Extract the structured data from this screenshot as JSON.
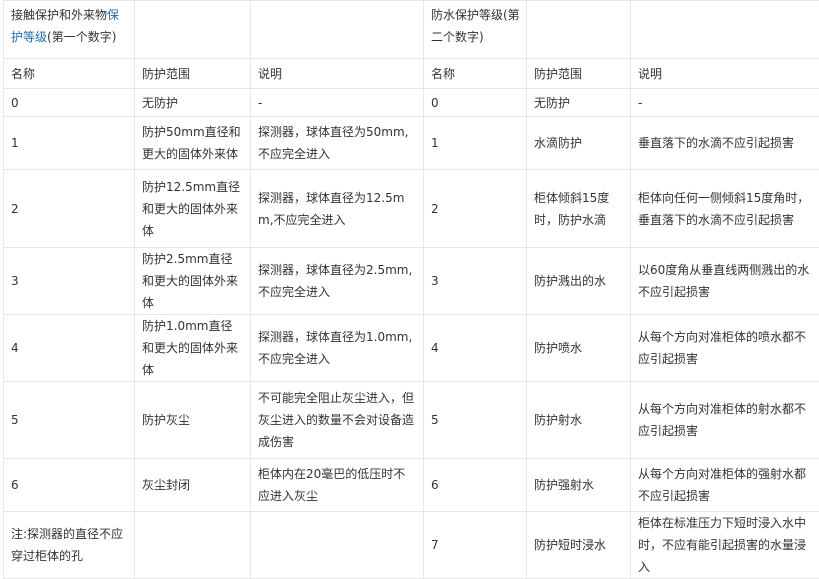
{
  "header": {
    "contact_title_prefix": "接触保护和外来物",
    "contact_title_link": "保护等级",
    "contact_title_suffix": "(第一个数字)",
    "water_title": "防水保护等级(第二个数字)"
  },
  "columns": {
    "name": "名称",
    "scope": "防护范围",
    "desc": "说明"
  },
  "rows": [
    {
      "c_name": "0",
      "c_scope": "无防护",
      "c_desc": "-",
      "w_name": "0",
      "w_scope": "无防护",
      "w_desc": "-"
    },
    {
      "c_name": "1",
      "c_scope": "防护50mm直径和更大的固体外来体",
      "c_desc": "探测器，球体直径为50mm,不应完全进入",
      "w_name": "1",
      "w_scope": "水滴防护",
      "w_desc": "垂直落下的水滴不应引起损害"
    },
    {
      "c_name": "2",
      "c_scope": "防护12.5mm直径和更大的固体外来体",
      "c_desc": "探测器，球体直径为12.5mm,不应完全进入",
      "w_name": "2",
      "w_scope": "柜体倾斜15度时，防护水滴",
      "w_desc": "柜体向任何一侧倾斜15度角时，垂直落下的水滴不应引起损害"
    },
    {
      "c_name": "3",
      "c_scope": "防护2.5mm直径和更大的固体外来体",
      "c_desc": "探测器，球体直径为2.5mm,不应完全进入",
      "w_name": "3",
      "w_scope": "防护溅出的水",
      "w_desc": "以60度角从垂直线两侧溅出的水不应引起损害"
    },
    {
      "c_name": "4",
      "c_scope": "防护1.0mm直径和更大的固体外来体",
      "c_desc": "探测器，球体直径为1.0mm,不应完全进入",
      "w_name": "4",
      "w_scope": "防护喷水",
      "w_desc": "从每个方向对准柜体的喷水都不应引起损害"
    },
    {
      "c_name": "5",
      "c_scope": "防护灰尘",
      "c_desc": "不可能完全阻止灰尘进入，但灰尘进入的数量不会对设备造成伤害",
      "w_name": "5",
      "w_scope": "防护射水",
      "w_desc": "从每个方向对准柜体的射水都不应引起损害"
    },
    {
      "c_name": "6",
      "c_scope": "灰尘封闭",
      "c_desc": "柜体内在20毫巴的低压时不应进入灰尘",
      "w_name": "6",
      "w_scope": "防护强射水",
      "w_desc": "从每个方向对准柜体的强射水都不应引起损害"
    },
    {
      "c_name": "注:探测器的直径不应穿过柜体的孔",
      "c_scope": "",
      "c_desc": "",
      "w_name": "7",
      "w_scope": "防护短时浸水",
      "w_desc": "柜体在标准压力下短时浸入水中时，不应有能引起损害的水量浸入"
    }
  ]
}
